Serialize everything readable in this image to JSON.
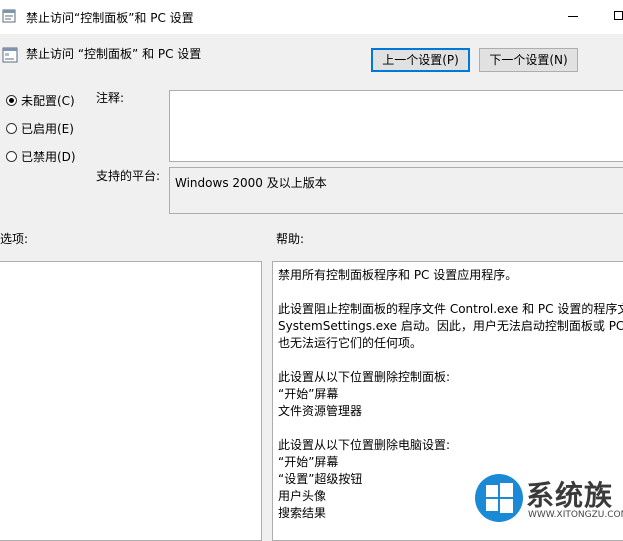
{
  "window": {
    "title": "禁止访问“控制面板”和 PC 设置"
  },
  "header": {
    "setting_name": "禁止访问 “控制面板” 和 PC 设置",
    "prev_button": "上一个设置(P)",
    "next_button": "下一个设置(N)"
  },
  "state": {
    "options": [
      {
        "label": "未配置(C)",
        "selected": true
      },
      {
        "label": "已启用(E)",
        "selected": false
      },
      {
        "label": "已禁用(D)",
        "selected": false
      }
    ]
  },
  "comment": {
    "label": "注释:",
    "value": ""
  },
  "platform": {
    "label": "支持的平台:",
    "value": "Windows 2000 及以上版本"
  },
  "options_section": {
    "label": "选项:"
  },
  "help_section": {
    "label": "帮助:",
    "lines": [
      "禁用所有控制面板程序和 PC 设置应用程序。",
      "",
      "此设置阻止控制面板的程序文件 Control.exe 和 PC 设置的程序文",
      "SystemSettings.exe 启动。因此，用户无法启动控制面板或 PC 设",
      "也无法运行它们的任何项。",
      "",
      "此设置从以下位置删除控制面板:",
      "  “开始”屏幕",
      "文件资源管理器",
      "",
      "此设置从以下位置删除电脑设置:",
      "  “开始”屏幕",
      "  “设置”超级按钮",
      "用户头像",
      "搜索结果"
    ]
  },
  "watermark": {
    "brand": "系统族",
    "url": "WWW.XITONGZU.COM"
  }
}
